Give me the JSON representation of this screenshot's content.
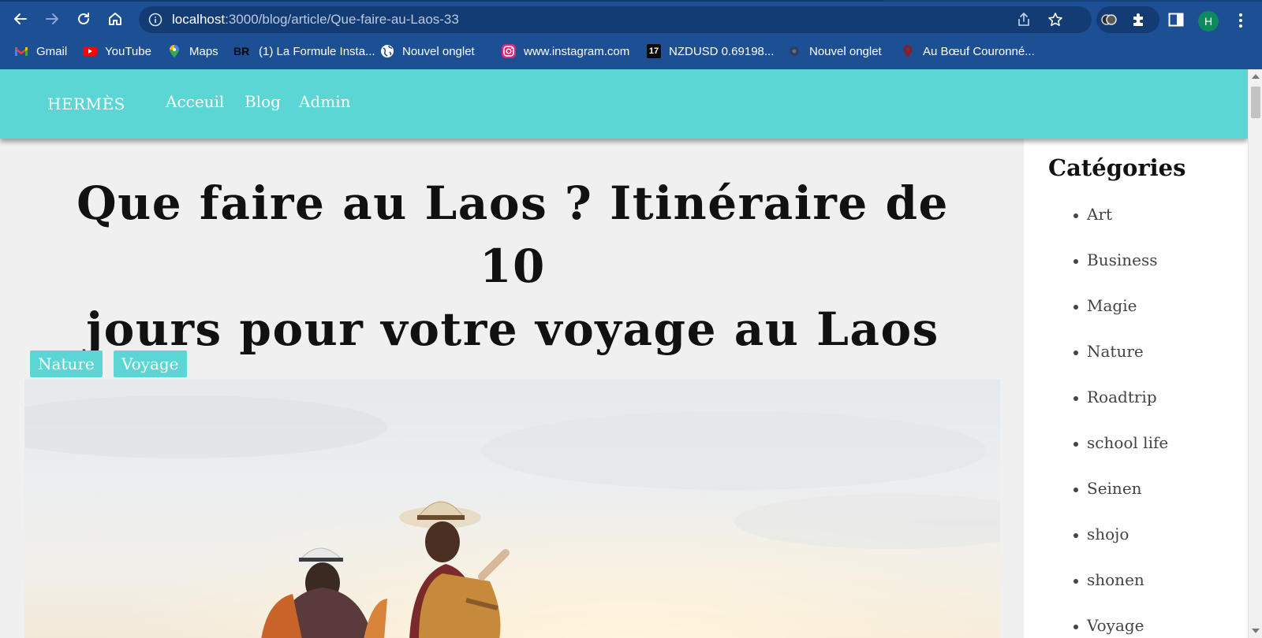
{
  "browser": {
    "url_host": "localhost",
    "url_path": ":3000/blog/article/Que-faire-au-Laos-33",
    "profile_initial": "H",
    "bookmarks": [
      {
        "label": "Gmail",
        "icon": "gmail-icon"
      },
      {
        "label": "YouTube",
        "icon": "youtube-icon"
      },
      {
        "label": "Maps",
        "icon": "maps-icon"
      },
      {
        "label": "(1) La Formule Insta...",
        "icon": "br-icon",
        "icon_text": "BR"
      },
      {
        "label": "Nouvel onglet",
        "icon": "globe-icon"
      },
      {
        "label": "www.instagram.com",
        "icon": "instagram-icon"
      },
      {
        "label": "NZDUSD 0.69198...",
        "icon": "tradingview-icon",
        "icon_text": "17"
      },
      {
        "label": "Nouvel onglet",
        "icon": "blank-page-icon"
      },
      {
        "label": "Au Bœuf Couronné...",
        "icon": "map-pin-icon"
      }
    ]
  },
  "site": {
    "brand": "HERMÈS",
    "nav": [
      "Acceuil",
      "Blog",
      "Admin"
    ],
    "header_color": "#5bd6d5"
  },
  "article": {
    "title_line1": "Que faire au Laos ? Itinéraire de 10",
    "title_line2": "jours pour votre voyage au Laos",
    "tags": [
      "Nature",
      "Voyage"
    ]
  },
  "sidebar": {
    "title": "Catégories",
    "categories": [
      "Art",
      "Business",
      "Magie",
      "Nature",
      "Roadtrip",
      "school life",
      "Seinen",
      "shojo",
      "shonen",
      "Voyage"
    ]
  }
}
